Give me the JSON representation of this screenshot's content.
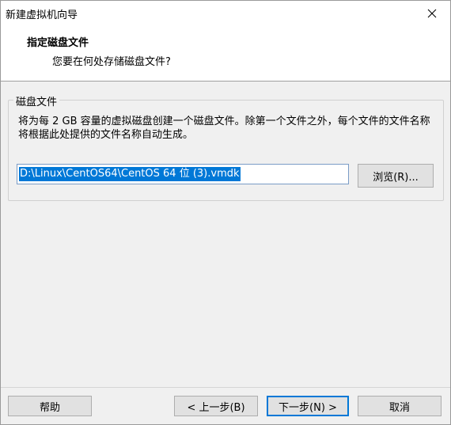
{
  "window": {
    "title": "新建虚拟机向导"
  },
  "header": {
    "title": "指定磁盘文件",
    "subtitle": "您要在何处存储磁盘文件?"
  },
  "group": {
    "label": "磁盘文件",
    "description": "将为每 2 GB 容量的虚拟磁盘创建一个磁盘文件。除第一个文件之外，每个文件的文件名称将根据此处提供的文件名称自动生成。"
  },
  "file_path": {
    "value": "D:\\Linux\\CentOS64\\CentOS 64 位 (3).vmdk"
  },
  "buttons": {
    "browse": "浏览(R)...",
    "help": "帮助",
    "back": "< 上一步(B)",
    "next": "下一步(N) >",
    "cancel": "取消"
  },
  "icons": {
    "close": "close-icon"
  }
}
